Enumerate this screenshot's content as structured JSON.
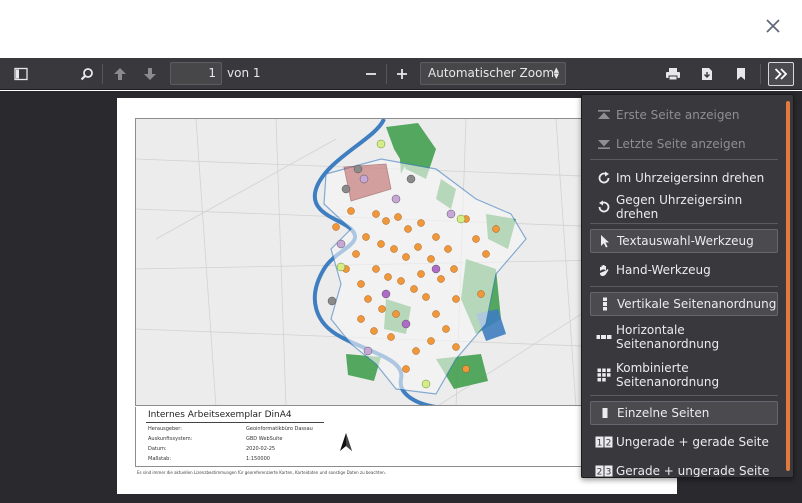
{
  "toolbar": {
    "page_number": "1",
    "page_of": "von 1",
    "zoom_value": "Automatischer Zoom"
  },
  "map_page": {
    "legend_title": "Internes Arbeitsexemplar  DinA4",
    "rows": [
      {
        "label": "Herausgeber:",
        "value": "Geoinformatikbüro Dassau"
      },
      {
        "label": "Auskunftssystem:",
        "value": "GBD WebSuite"
      },
      {
        "label": "Datum:",
        "value": "2020-02-25"
      },
      {
        "label": "Maßstab:",
        "value": "1:150000"
      }
    ],
    "footnote": "Es sind immer die aktuellen Lizenzbestimmungen für georeferenzierte Karten, Karteidaten und sonstige Daten zu beachten."
  },
  "menu": {
    "items": [
      {
        "label": "Erste Seite anzeigen",
        "icon": "first-page-icon",
        "state": "disabled"
      },
      {
        "label": "Letzte Seite anzeigen",
        "icon": "last-page-icon",
        "state": "disabled"
      },
      {
        "label": "Im Uhrzeigersinn drehen",
        "icon": "rotate-cw-icon",
        "state": "normal"
      },
      {
        "label": "Gegen Uhrzeigersinn drehen",
        "icon": "rotate-ccw-icon",
        "state": "normal"
      },
      {
        "label": "Textauswahl-Werkzeug",
        "icon": "cursor-icon",
        "state": "active"
      },
      {
        "label": "Hand-Werkzeug",
        "icon": "hand-icon",
        "state": "normal"
      },
      {
        "label": "Vertikale Seitenanordnung",
        "icon": "vertical-scroll-icon",
        "state": "active"
      },
      {
        "label": "Horizontale Seitenanordnung",
        "icon": "horizontal-scroll-icon",
        "state": "normal"
      },
      {
        "label": "Kombinierte Seitenanordnung",
        "icon": "wrapped-scroll-icon",
        "state": "normal"
      },
      {
        "label": "Einzelne Seiten",
        "icon": "single-page-icon",
        "state": "active"
      },
      {
        "label": "Ungerade + gerade Seite",
        "icon": "odd-spread-icon",
        "state": "normal"
      },
      {
        "label": "Gerade + ungerade Seite",
        "icon": "even-spread-icon",
        "state": "normal"
      }
    ]
  },
  "colors": {
    "toolbar_bg": "#38383d",
    "viewer_bg": "#2a2a2e",
    "accent_scrollbar": "#e07a3e",
    "map_river": "#3f7ec0",
    "map_forest": "#3a9b46",
    "map_poi": "#f0973a"
  }
}
